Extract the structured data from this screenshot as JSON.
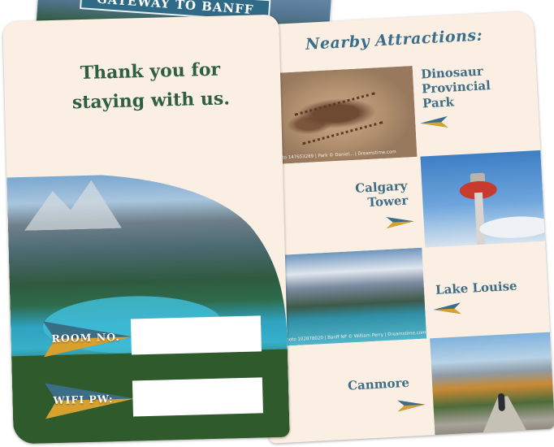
{
  "banner": {
    "title": "GATEWAY TO BANFF"
  },
  "left_card": {
    "thanks_line1": "Thank you for",
    "thanks_line2": "staying with us.",
    "room_label": "ROOM NO.",
    "wifi_label": "WIFI PW:",
    "room_value": "",
    "wifi_value": ""
  },
  "right_card": {
    "title": "Nearby Attractions:",
    "attractions": [
      {
        "name_lines": [
          "Dinosaur",
          "Provincial",
          "Park"
        ],
        "credit": "Photo 147653289 | Park © Daniel... | Dreamstime.com"
      },
      {
        "name_lines": [
          "Calgary",
          "Tower"
        ],
        "credit": ""
      },
      {
        "name_lines": [
          "Lake Louise"
        ],
        "credit": "Photo 102878020 | Banff NP © William Perry | Dreamstime.com"
      },
      {
        "name_lines": [
          "Canmore"
        ],
        "credit": ""
      }
    ]
  },
  "colors": {
    "card_bg": "#fbeee2",
    "title_green": "#2f5f43",
    "attraction_blue": "#3f6e86",
    "arrow_teal": "#3a6e86",
    "arrow_gold": "#d8a12e"
  }
}
